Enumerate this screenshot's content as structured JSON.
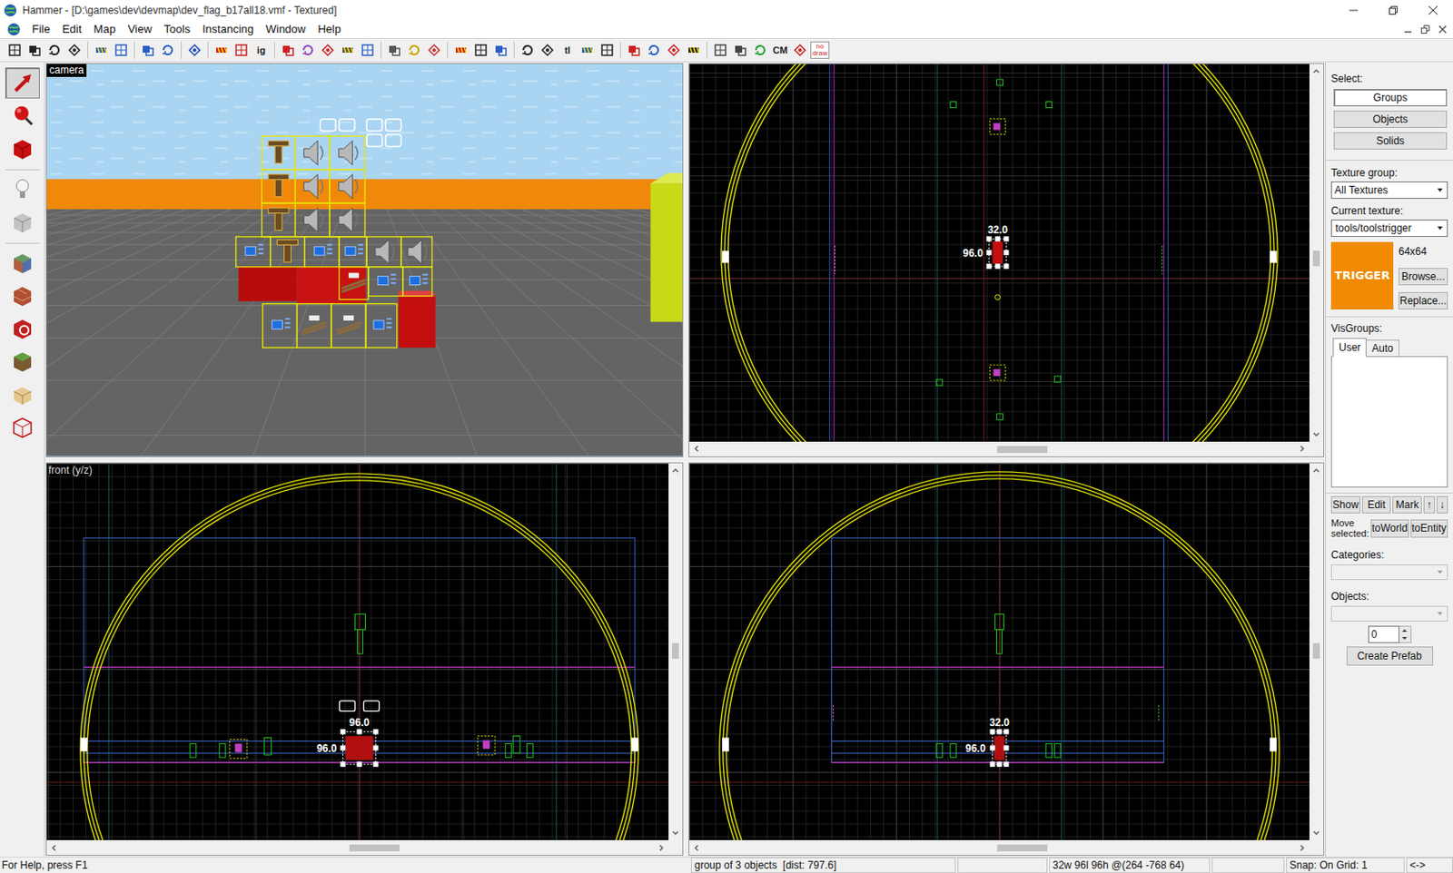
{
  "window": {
    "title": "Hammer - [D:\\games\\dev\\devmap\\dev_flag_b17all18.vmf - Textured]"
  },
  "menu": [
    "File",
    "Edit",
    "Map",
    "View",
    "Tools",
    "Instancing",
    "Window",
    "Help"
  ],
  "toolbar": [
    {
      "kind": "icon"
    },
    {
      "kind": "icon"
    },
    {
      "kind": "icon"
    },
    {
      "kind": "icon"
    },
    {
      "kind": "separator"
    },
    {
      "kind": "icon"
    },
    {
      "kind": "icon"
    },
    {
      "kind": "separator"
    },
    {
      "kind": "icon"
    },
    {
      "kind": "icon"
    },
    {
      "kind": "separator"
    },
    {
      "kind": "icon"
    },
    {
      "kind": "separator"
    },
    {
      "kind": "icon"
    },
    {
      "kind": "icon"
    },
    {
      "kind": "text",
      "label": "ig"
    },
    {
      "kind": "separator"
    },
    {
      "kind": "icon"
    },
    {
      "kind": "icon"
    },
    {
      "kind": "icon"
    },
    {
      "kind": "icon"
    },
    {
      "kind": "icon"
    },
    {
      "kind": "separator"
    },
    {
      "kind": "icon"
    },
    {
      "kind": "icon"
    },
    {
      "kind": "icon"
    },
    {
      "kind": "separator"
    },
    {
      "kind": "icon"
    },
    {
      "kind": "icon"
    },
    {
      "kind": "icon"
    },
    {
      "kind": "separator"
    },
    {
      "kind": "icon"
    },
    {
      "kind": "icon"
    },
    {
      "kind": "text",
      "label": "tl"
    },
    {
      "kind": "icon"
    },
    {
      "kind": "icon"
    },
    {
      "kind": "separator"
    },
    {
      "kind": "icon"
    },
    {
      "kind": "icon"
    },
    {
      "kind": "icon"
    },
    {
      "kind": "icon"
    },
    {
      "kind": "separator"
    },
    {
      "kind": "icon"
    },
    {
      "kind": "icon"
    },
    {
      "kind": "icon"
    },
    {
      "kind": "text",
      "label": "CM"
    },
    {
      "kind": "icon"
    },
    {
      "kind": "tag",
      "label": "no draw"
    }
  ],
  "tools": [
    {
      "selected": true
    },
    {
      "selected": false
    },
    {
      "selected": false
    },
    {
      "selected": false
    },
    {
      "selected": false
    },
    {
      "selected": false
    },
    {
      "selected": false
    },
    {
      "selected": false
    },
    {
      "selected": false
    },
    {
      "selected": false
    },
    {
      "selected": false
    }
  ],
  "viewports": {
    "camera": {
      "label": "camera"
    },
    "top": {
      "dims": [
        "32.0",
        "96.0"
      ]
    },
    "front": {
      "label": "front (y/z)",
      "dims": [
        "96.0",
        "96.0"
      ]
    },
    "side": {
      "dims": [
        "32.0",
        "96.0"
      ]
    }
  },
  "side_panel": {
    "select_label": "Select:",
    "select_buttons": [
      {
        "label": "Groups",
        "selected": true
      },
      {
        "label": "Objects",
        "selected": false
      },
      {
        "label": "Solids",
        "selected": false
      }
    ],
    "texture_group_label": "Texture group:",
    "texture_group": "All Textures",
    "current_texture_label": "Current texture:",
    "current_texture": "tools/toolstrigger",
    "texture_preview": "TRIGGER",
    "texture_size": "64x64",
    "browse": "Browse...",
    "replace": "Replace...",
    "visgroups_label": "VisGroups:",
    "visgroup_tabs": [
      {
        "label": "User",
        "selected": true
      },
      {
        "label": "Auto",
        "selected": false
      }
    ],
    "visgroup_buttons": [
      "Show",
      "Edit",
      "Mark",
      "↑",
      "↓"
    ],
    "move_selected_label": "Move selected:",
    "move_buttons": [
      "toWorld",
      "toEntity"
    ],
    "categories_label": "Categories:",
    "objects_label": "Objects:",
    "count": "0",
    "create_prefab": "Create Prefab"
  },
  "status_bar": {
    "help": "For Help, press F1",
    "selection": "group of 3 objects  [dist: 797.6]",
    "size": "32w 96l 96h @(264 -768 64)",
    "snap": "Snap: On Grid: 1",
    "end": "<->"
  }
}
